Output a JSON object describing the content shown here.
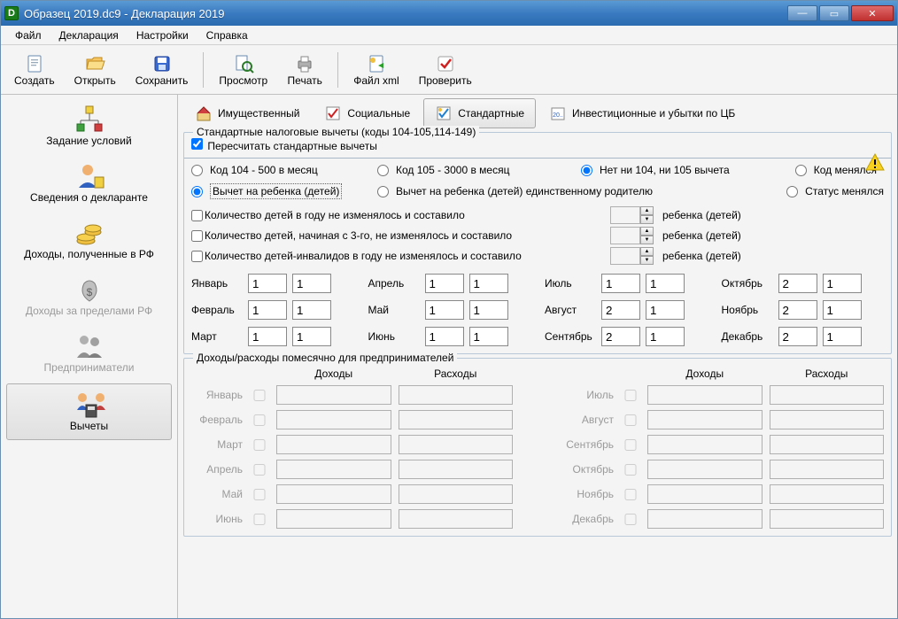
{
  "window": {
    "title": "Образец 2019.dc9 - Декларация 2019"
  },
  "menu": {
    "file": "Файл",
    "declaration": "Декларация",
    "settings": "Настройки",
    "help": "Справка"
  },
  "toolbar": {
    "new": "Создать",
    "open": "Открыть",
    "save": "Сохранить",
    "preview": "Просмотр",
    "print": "Печать",
    "xml": "Файл xml",
    "check": "Проверить"
  },
  "sidebar": {
    "conditions": "Задание условий",
    "declarant": "Сведения о декларанте",
    "income_rf": "Доходы, полученные в РФ",
    "income_abroad": "Доходы за пределами РФ",
    "entrepreneurs": "Предприниматели",
    "deductions": "Вычеты"
  },
  "tabs": {
    "property": "Имущественный",
    "social": "Социальные",
    "standard": "Стандартные",
    "invest": "Инвестиционные и убытки по ЦБ"
  },
  "group1": {
    "legend": "Стандартные налоговые вычеты (коды 104-105,114-149)",
    "recalc": "Пересчитать стандартные вычеты",
    "code104": "Код 104 - 500 в месяц",
    "code105": "Код 105 - 3000 в месяц",
    "none": "Нет ни 104, ни 105 вычета",
    "changed": "Код менялся",
    "deduct_child": "Вычет на ребенка (детей)",
    "deduct_child_single": "Вычет на ребенка (детей) единственному родителю",
    "status_changed": "Статус менялся",
    "count1": "Количество детей в году не изменялось и составило",
    "count2": "Количество детей, начиная с 3-го, не изменялось и составило",
    "count3": "Количество детей-инвалидов в году не изменялось и составило",
    "children_unit": "ребенка (детей)"
  },
  "months": {
    "jan": {
      "name": "Январь",
      "v1": "1",
      "v2": "1"
    },
    "feb": {
      "name": "Февраль",
      "v1": "1",
      "v2": "1"
    },
    "mar": {
      "name": "Март",
      "v1": "1",
      "v2": "1"
    },
    "apr": {
      "name": "Апрель",
      "v1": "1",
      "v2": "1"
    },
    "may": {
      "name": "Май",
      "v1": "1",
      "v2": "1"
    },
    "jun": {
      "name": "Июнь",
      "v1": "1",
      "v2": "1"
    },
    "jul": {
      "name": "Июль",
      "v1": "1",
      "v2": "1"
    },
    "aug": {
      "name": "Август",
      "v1": "2",
      "v2": "1"
    },
    "sep": {
      "name": "Сентябрь",
      "v1": "2",
      "v2": "1"
    },
    "oct": {
      "name": "Октябрь",
      "v1": "2",
      "v2": "1"
    },
    "nov": {
      "name": "Ноябрь",
      "v1": "2",
      "v2": "1"
    },
    "dec": {
      "name": "Декабрь",
      "v1": "2",
      "v2": "1"
    }
  },
  "group2": {
    "legend": "Доходы/расходы помесячно для предпринимателей",
    "income_hdr": "Доходы",
    "expense_hdr": "Расходы",
    "m1": "Январь",
    "m2": "Февраль",
    "m3": "Март",
    "m4": "Апрель",
    "m5": "Май",
    "m6": "Июнь",
    "m7": "Июль",
    "m8": "Август",
    "m9": "Сентябрь",
    "m10": "Октябрь",
    "m11": "Ноябрь",
    "m12": "Декабрь"
  }
}
